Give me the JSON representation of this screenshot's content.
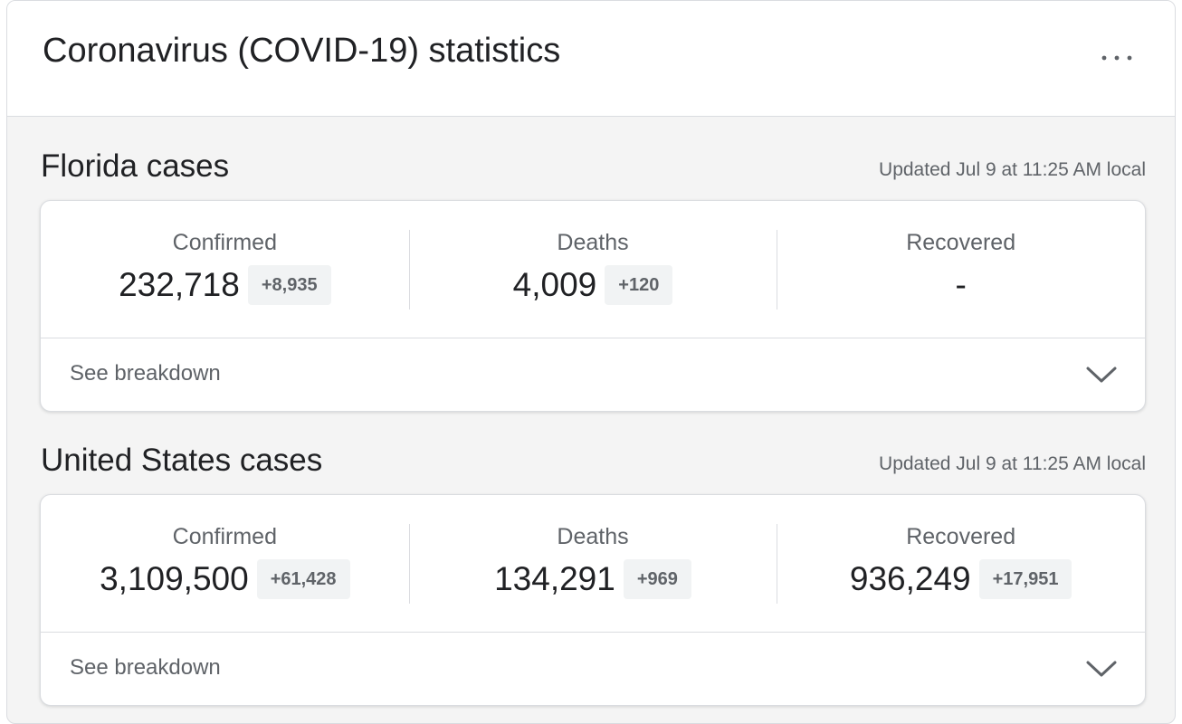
{
  "header": {
    "title": "Coronavirus (COVID-19) statistics",
    "more_label": "..."
  },
  "sections": [
    {
      "title": "Florida cases",
      "updated": "Updated Jul 9 at 11:25 AM local",
      "stats": [
        {
          "label": "Confirmed",
          "value": "232,718",
          "delta": "+8,935"
        },
        {
          "label": "Deaths",
          "value": "4,009",
          "delta": "+120"
        },
        {
          "label": "Recovered",
          "value": "-",
          "delta": ""
        }
      ],
      "breakdown_label": "See breakdown"
    },
    {
      "title": "United States cases",
      "updated": "Updated Jul 9 at 11:25 AM local",
      "stats": [
        {
          "label": "Confirmed",
          "value": "3,109,500",
          "delta": "+61,428"
        },
        {
          "label": "Deaths",
          "value": "134,291",
          "delta": "+969"
        },
        {
          "label": "Recovered",
          "value": "936,249",
          "delta": "+17,951"
        }
      ],
      "breakdown_label": "See breakdown"
    }
  ],
  "icons": {
    "more": "more-horiz-icon",
    "expand": "chevron-down-icon"
  },
  "colors": {
    "text_primary": "#202124",
    "text_secondary": "#5f6368",
    "panel_bg": "#f4f4f4",
    "divider": "#dadce0"
  }
}
